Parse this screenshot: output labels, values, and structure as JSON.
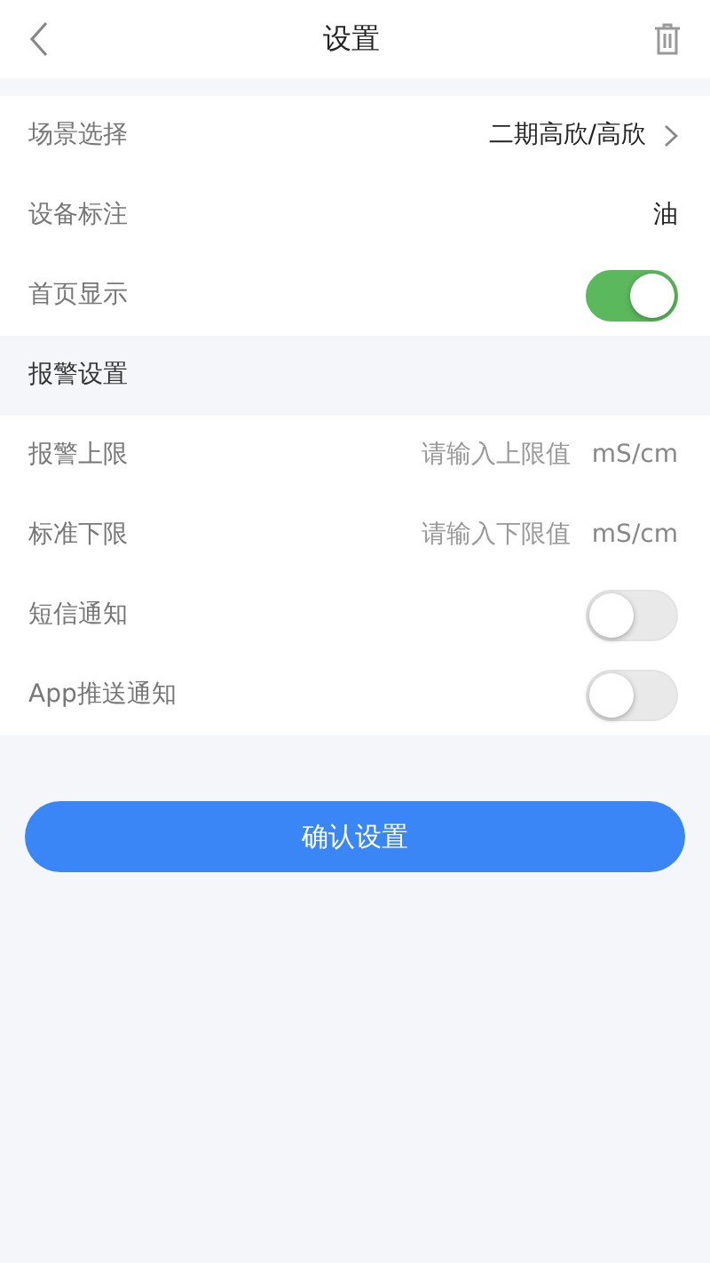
{
  "header": {
    "title": "设置"
  },
  "groups": [
    {
      "rows": [
        {
          "kind": "link",
          "label": "场景选择",
          "value": "二期高欣/高欣"
        },
        {
          "kind": "text",
          "label": "设备标注",
          "value": "油"
        },
        {
          "kind": "switch",
          "label": "首页显示",
          "on": true
        }
      ]
    },
    {
      "title": "报警设置",
      "rows": [
        {
          "kind": "input",
          "label": "报警上限",
          "placeholder": "请输入上限值",
          "unit": "mS/cm"
        },
        {
          "kind": "input",
          "label": "标准下限",
          "placeholder": "请输入下限值",
          "unit": "mS/cm"
        },
        {
          "kind": "switch",
          "label": "短信通知",
          "on": false
        },
        {
          "kind": "switch",
          "label": "App推送通知",
          "on": false
        }
      ]
    }
  ],
  "confirm_button": "确认设置"
}
